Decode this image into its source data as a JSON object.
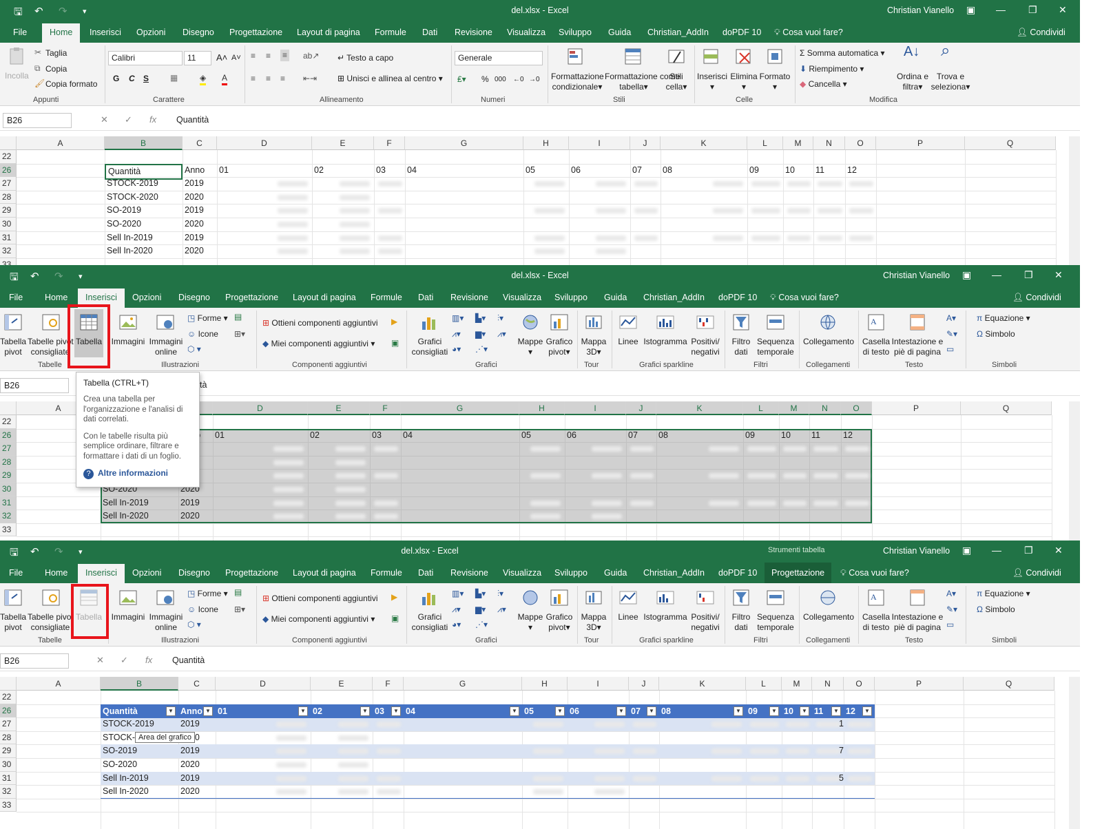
{
  "app": {
    "file_title": "del.xlsx  -  Excel",
    "user": "Christian Vianello",
    "share_label": "Condividi",
    "tell_me": "Cosa vuoi fare?",
    "context_tools": "Strumenti tabella"
  },
  "menu": {
    "file": "File",
    "home": "Home",
    "insert": "Inserisci",
    "options": "Opzioni",
    "draw": "Disegno",
    "design": "Progettazione",
    "layout": "Layout di pagina",
    "formulas": "Formule",
    "data": "Dati",
    "review": "Revisione",
    "view": "Visualizza",
    "developer": "Sviluppo",
    "help": "Guida",
    "addin": "Christian_AddIn",
    "dopdf": "doPDF 10",
    "table_design": "Progettazione"
  },
  "home_ribbon": {
    "paste": "Incolla",
    "cut": "Taglia",
    "copy": "Copia",
    "format_painter": "Copia formato",
    "clipboard": "Appunti",
    "font_name": "Calibri",
    "font_size": "11",
    "bold": "G",
    "italic": "C",
    "underline": "S",
    "font_group": "Carattere",
    "wrap": "Testo a capo",
    "merge": "Unisci e allinea al centro",
    "alignment": "Allineamento",
    "number_format": "Generale",
    "percent": "%",
    "thousands": "000",
    "numbers": "Numeri",
    "cond_format_1": "Formattazione",
    "cond_format_2": "condizionale",
    "format_table_1": "Formattazione come",
    "format_table_2": "tabella",
    "cell_styles_1": "Stili",
    "cell_styles_2": "cella",
    "styles": "Stili",
    "insert": "Inserisci",
    "delete": "Elimina",
    "format": "Formato",
    "cells": "Celle",
    "autosum": "Somma automatica",
    "fill": "Riempimento",
    "clear": "Cancella",
    "sort_1": "Ordina e",
    "sort_2": "filtra",
    "find_1": "Trova e",
    "find_2": "seleziona",
    "editing": "Modifica"
  },
  "insert_ribbon": {
    "pivot_1": "Tabella",
    "pivot_2": "pivot",
    "rec_pivot_1": "Tabelle pivot",
    "rec_pivot_2": "consigliate",
    "table": "Tabella",
    "tables": "Tabelle",
    "images": "Immagini",
    "online_images_1": "Immagini",
    "online_images_2": "online",
    "shapes": "Forme",
    "icons": "Icone",
    "illustrations": "Illustrazioni",
    "get_addins": "Ottieni componenti aggiuntivi",
    "my_addins": "Miei componenti aggiuntivi",
    "addins": "Componenti aggiuntivi",
    "rec_charts_1": "Grafici",
    "rec_charts_2": "consigliati",
    "maps": "Mappe",
    "pivot_chart_1": "Grafico",
    "pivot_chart_2": "pivot",
    "charts": "Grafici",
    "map3d_1": "Mappa",
    "map3d_2": "3D",
    "tour": "Tour",
    "lines": "Linee",
    "histogram": "Istogramma",
    "winloss_1": "Positivi/",
    "winloss_2": "negativi",
    "sparklines": "Grafici sparkline",
    "slicer_1": "Filtro",
    "slicer_2": "dati",
    "timeline_1": "Sequenza",
    "timeline_2": "temporale",
    "filters": "Filtri",
    "link": "Collegamento",
    "links": "Collegamenti",
    "textbox_1": "Casella",
    "textbox_2": "di testo",
    "header_1": "Intestazione e",
    "header_2": "piè di pagina",
    "text": "Testo",
    "equation": "Equazione",
    "symbol": "Simbolo",
    "symbols": "Simboli"
  },
  "formula_bar": {
    "name_box": "B26",
    "value": "Quantità",
    "fx": "fx",
    "partial_value": "tà"
  },
  "columns": [
    "A",
    "B",
    "C",
    "D",
    "E",
    "F",
    "G",
    "H",
    "I",
    "J",
    "K",
    "L",
    "M",
    "N",
    "O",
    "P",
    "Q"
  ],
  "rows": [
    "22",
    "26",
    "27",
    "28",
    "29",
    "30",
    "31",
    "32",
    "33"
  ],
  "table": {
    "headers": [
      "Quantità",
      "Anno",
      "01",
      "02",
      "03",
      "04",
      "05",
      "06",
      "07",
      "08",
      "09",
      "10",
      "11",
      "12"
    ],
    "rows": [
      {
        "label": "STOCK-2019",
        "year": "2019"
      },
      {
        "label": "STOCK-2020",
        "year": "2020"
      },
      {
        "label": "SO-2019",
        "year": "2019"
      },
      {
        "label": "SO-2020",
        "year": "2020"
      },
      {
        "label": "Sell In-2019",
        "year": "2019"
      },
      {
        "label": "Sell In-2020",
        "year": "2020"
      }
    ],
    "partial_label": "STOCK-",
    "edge_digits": [
      "1",
      "7",
      "5"
    ]
  },
  "tooltip": {
    "title": "Tabella (CTRL+T)",
    "body1": "Crea una tabella per l'organizzazione e l'analisi di dati correlati.",
    "body2": "Con le tabelle risulta più semplice ordinare, filtrare e formattare i dati di un foglio.",
    "link": "Altre informazioni",
    "chart_area": "Area del grafico"
  },
  "colors": {
    "excel_green": "#217346",
    "table_header": "#4472c4",
    "table_band": "#dae3f3",
    "highlight_red": "#e8141b"
  }
}
